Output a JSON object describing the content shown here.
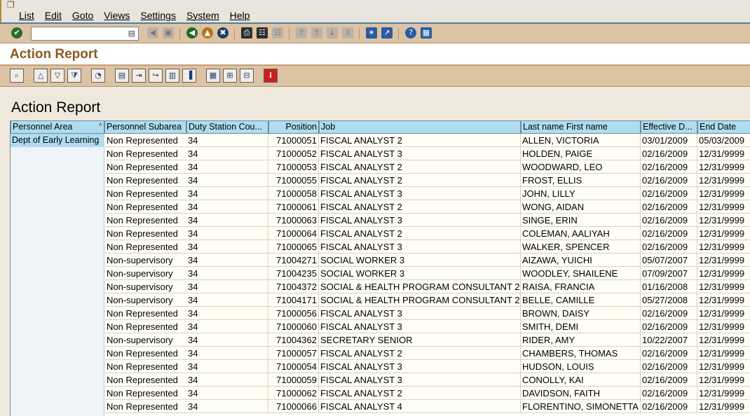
{
  "menu": {
    "items": [
      "List",
      "Edit",
      "Goto",
      "Views",
      "Settings",
      "System",
      "Help"
    ]
  },
  "toolbar": {
    "command_value": "",
    "icons": [
      "enter-icon",
      "save-icon",
      "back-icon",
      "exit-icon",
      "cancel-icon",
      "print-icon",
      "find-icon",
      "find-next-icon",
      "first-page-icon",
      "previous-page-icon",
      "next-page-icon",
      "last-page-icon",
      "create-session-icon",
      "shortcut-icon",
      "help-icon",
      "layout-icon"
    ]
  },
  "title": "Action Report",
  "report": {
    "heading": "Action Report",
    "columns": [
      {
        "label": "Personnel Area"
      },
      {
        "label": "Personnel Subarea"
      },
      {
        "label": "Duty Station Cou..."
      },
      {
        "label": "Position"
      },
      {
        "label": "Job"
      },
      {
        "label": "Last name First name"
      },
      {
        "label": "Effective D..."
      },
      {
        "label": "End Date"
      }
    ],
    "group_value": "Dept of Early Learning",
    "rows": [
      {
        "subarea": "Non Represented",
        "duty": "34",
        "position": "71000051",
        "job": "FISCAL ANALYST 2",
        "name": "ALLEN, VICTORIA",
        "eff": "03/01/2009",
        "end": "05/03/2009"
      },
      {
        "subarea": "Non Represented",
        "duty": "34",
        "position": "71000052",
        "job": "FISCAL ANALYST 3",
        "name": "HOLDEN, PAIGE",
        "eff": "02/16/2009",
        "end": "12/31/9999"
      },
      {
        "subarea": "Non Represented",
        "duty": "34",
        "position": "71000053",
        "job": "FISCAL ANALYST 2",
        "name": "WOODWARD, LEO",
        "eff": "02/16/2009",
        "end": "12/31/9999"
      },
      {
        "subarea": "Non Represented",
        "duty": "34",
        "position": "71000055",
        "job": "FISCAL ANALYST 2",
        "name": "FROST, ELLIS",
        "eff": "02/16/2009",
        "end": "12/31/9999"
      },
      {
        "subarea": "Non Represented",
        "duty": "34",
        "position": "71000058",
        "job": "FISCAL ANALYST 3",
        "name": "JOHN, LILLY",
        "eff": "02/16/2009",
        "end": "12/31/9999"
      },
      {
        "subarea": "Non Represented",
        "duty": "34",
        "position": "71000061",
        "job": "FISCAL ANALYST 2",
        "name": "WONG, AIDAN",
        "eff": "02/16/2009",
        "end": "12/31/9999"
      },
      {
        "subarea": "Non Represented",
        "duty": "34",
        "position": "71000063",
        "job": "FISCAL ANALYST 3",
        "name": "SINGE, ERIN",
        "eff": "02/16/2009",
        "end": "12/31/9999"
      },
      {
        "subarea": "Non Represented",
        "duty": "34",
        "position": "71000064",
        "job": "FISCAL ANALYST 2",
        "name": "COLEMAN, AALIYAH",
        "eff": "02/16/2009",
        "end": "12/31/9999"
      },
      {
        "subarea": "Non Represented",
        "duty": "34",
        "position": "71000065",
        "job": "FISCAL ANALYST 3",
        "name": "WALKER, SPENCER",
        "eff": "02/16/2009",
        "end": "12/31/9999"
      },
      {
        "subarea": "Non-supervisory",
        "duty": "34",
        "position": "71004271",
        "job": "SOCIAL WORKER 3",
        "name": "AIZAWA, YUICHI",
        "eff": "05/07/2007",
        "end": "12/31/9999"
      },
      {
        "subarea": "Non-supervisory",
        "duty": "34",
        "position": "71004235",
        "job": "SOCIAL WORKER 3",
        "name": "WOODLEY, SHAILENE",
        "eff": "07/09/2007",
        "end": "12/31/9999"
      },
      {
        "subarea": "Non-supervisory",
        "duty": "34",
        "position": "71004372",
        "job": "SOCIAL & HEALTH PROGRAM CONSULTANT 2",
        "name": "RAISA, FRANCIA",
        "eff": "01/16/2008",
        "end": "12/31/9999"
      },
      {
        "subarea": "Non-supervisory",
        "duty": "34",
        "position": "71004171",
        "job": "SOCIAL & HEALTH PROGRAM CONSULTANT 2",
        "name": "BELLE, CAMILLE",
        "eff": "05/27/2008",
        "end": "12/31/9999"
      },
      {
        "subarea": "Non Represented",
        "duty": "34",
        "position": "71000056",
        "job": "FISCAL ANALYST 3",
        "name": "BROWN, DAISY",
        "eff": "02/16/2009",
        "end": "12/31/9999"
      },
      {
        "subarea": "Non Represented",
        "duty": "34",
        "position": "71000060",
        "job": "FISCAL ANALYST 3",
        "name": "SMITH, DEMI",
        "eff": "02/16/2009",
        "end": "12/31/9999"
      },
      {
        "subarea": "Non-supervisory",
        "duty": "34",
        "position": "71004362",
        "job": "SECRETARY SENIOR",
        "name": "RIDER, AMY",
        "eff": "10/22/2007",
        "end": "12/31/9999"
      },
      {
        "subarea": "Non Represented",
        "duty": "34",
        "position": "71000057",
        "job": "FISCAL ANALYST 2",
        "name": "CHAMBERS, THOMAS",
        "eff": "02/16/2009",
        "end": "12/31/9999"
      },
      {
        "subarea": "Non Represented",
        "duty": "34",
        "position": "71000054",
        "job": "FISCAL ANALYST 3",
        "name": "HUDSON, LOUIS",
        "eff": "02/16/2009",
        "end": "12/31/9999"
      },
      {
        "subarea": "Non Represented",
        "duty": "34",
        "position": "71000059",
        "job": "FISCAL ANALYST 3",
        "name": "CONOLLY, KAI",
        "eff": "02/16/2009",
        "end": "12/31/9999"
      },
      {
        "subarea": "Non Represented",
        "duty": "34",
        "position": "71000062",
        "job": "FISCAL ANALYST 2",
        "name": "DAVIDSON, FAITH",
        "eff": "02/16/2009",
        "end": "12/31/9999"
      },
      {
        "subarea": "Non Represented",
        "duty": "34",
        "position": "71000066",
        "job": "FISCAL ANALYST 4",
        "name": "FLORENTINO, SIMONETTA",
        "eff": "02/16/2009",
        "end": "12/31/9999"
      }
    ]
  }
}
